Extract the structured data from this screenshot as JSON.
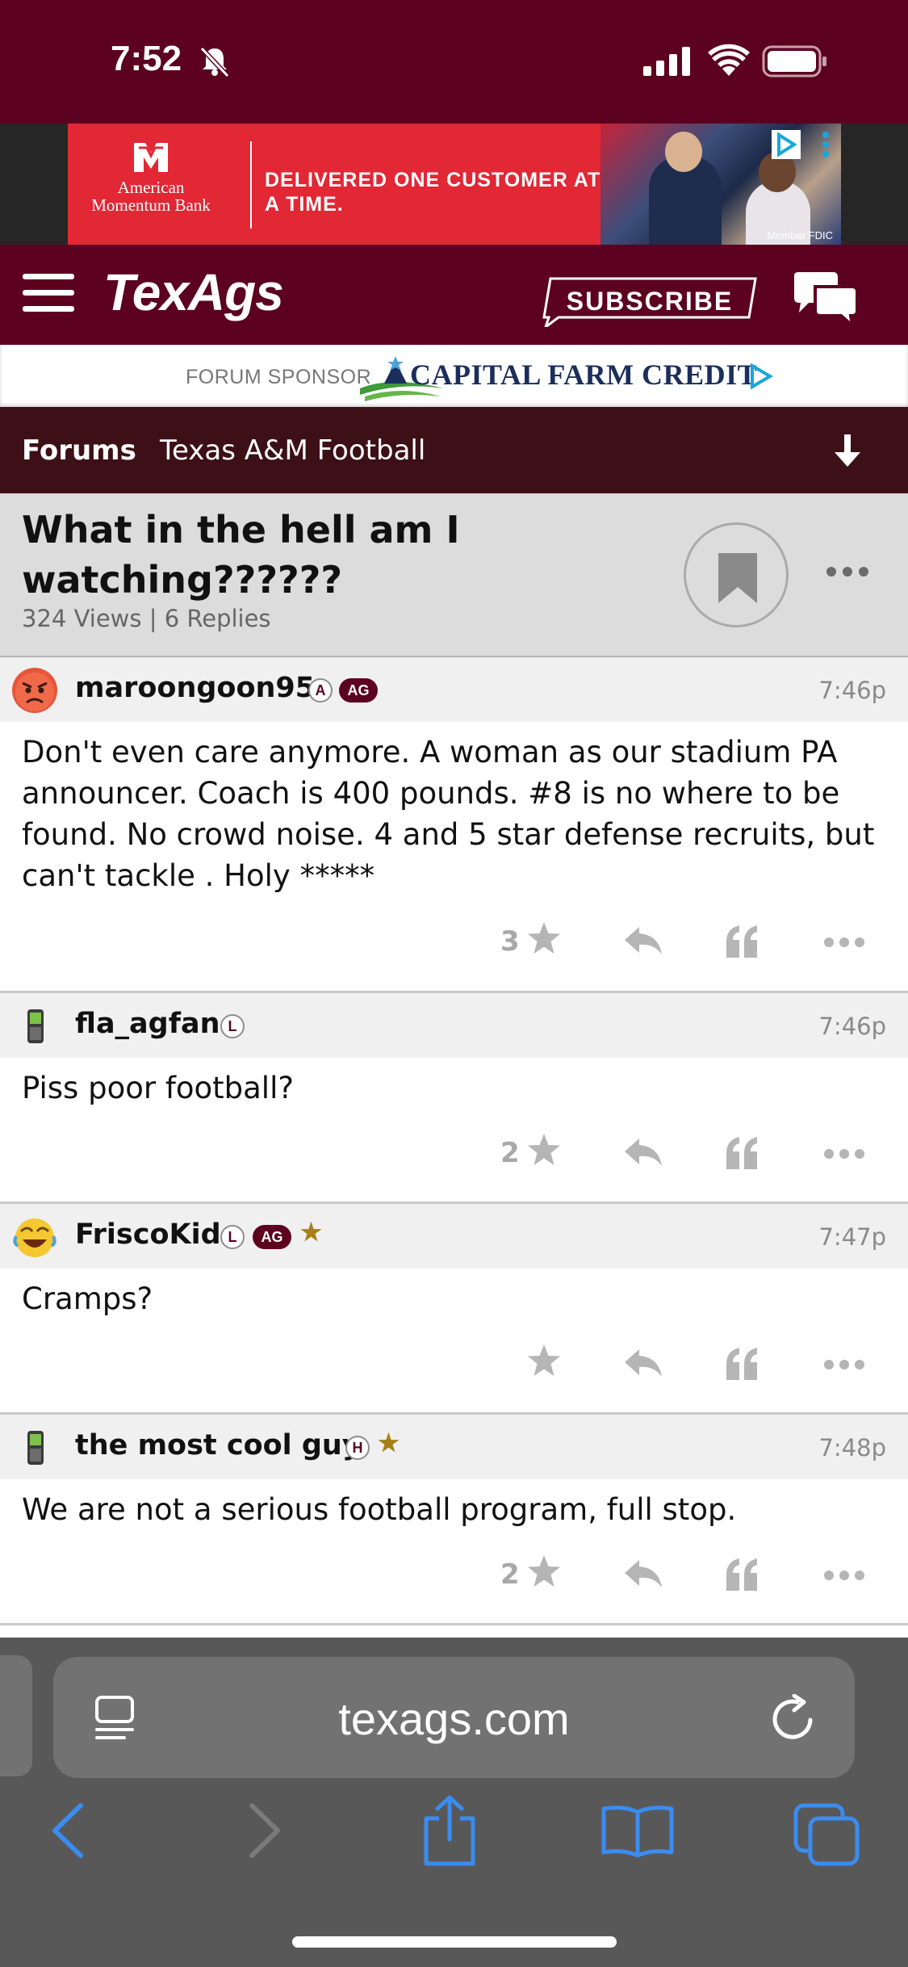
{
  "status_bar": {
    "time": "7:52"
  },
  "ad": {
    "brand": "American Momentum Bank",
    "headline": "DELIVERED ONE CUSTOMER AT A TIME.",
    "footer": "Member FDIC",
    "accent_color": "#e22735"
  },
  "header": {
    "logo": "TexAgs",
    "subscribe_label": "SUBSCRIBE",
    "brand_color": "#5c0120"
  },
  "sponsor": {
    "label": "FORUM SPONSOR",
    "name": "CAPITAL FARM CREDIT"
  },
  "breadcrumb": {
    "forums": "Forums",
    "board": "Texas A&M Football"
  },
  "thread": {
    "title": "What in the hell am I watching??????",
    "stats": "324 Views | 6 Replies"
  },
  "posts": [
    {
      "username": "maroongoon95",
      "badges": [
        "A",
        "AG"
      ],
      "time": "7:46p",
      "body": "Don't even care anymore. A woman as our stadium PA announcer. Coach is 400 pounds. #8 is no where to be found. No crowd noise. 4 and 5 star defense recruits, but can't tackle . Holy *****",
      "likes": "3",
      "avatar_icon": "angry-face-icon"
    },
    {
      "username": "fla_agfan",
      "badges": [
        "L"
      ],
      "time": "7:46p",
      "body": "Piss poor football?",
      "likes": "2",
      "avatar_icon": "phone-icon"
    },
    {
      "username": "FriscoKid",
      "badges": [
        "L",
        "AG"
      ],
      "time": "7:47p",
      "body": "Cramps?",
      "likes": "",
      "avatar_icon": "laughing-face-icon"
    },
    {
      "username": "the most cool guy",
      "badges": [
        "H"
      ],
      "time": "7:48p",
      "body": "We are not a serious football program, full stop.",
      "likes": "2",
      "avatar_icon": "phone-icon"
    }
  ],
  "browser": {
    "url": "texags.com"
  }
}
